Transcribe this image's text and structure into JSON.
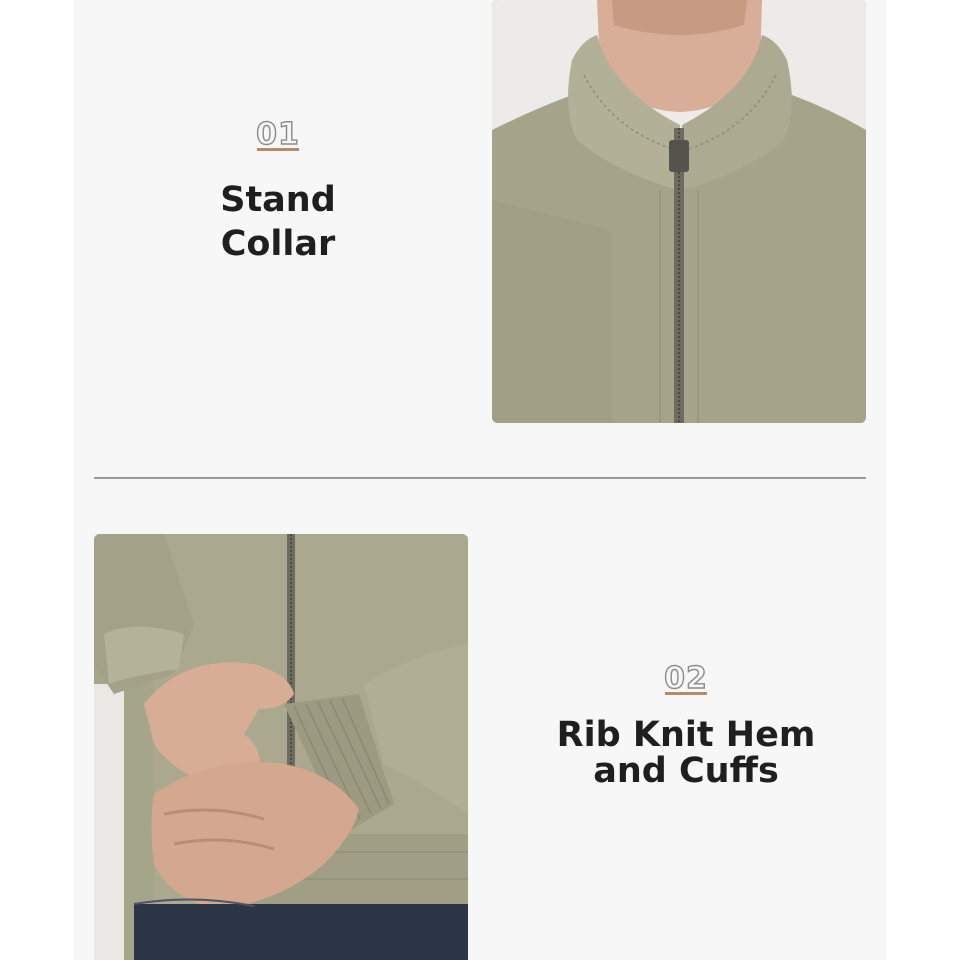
{
  "features": [
    {
      "number": "01",
      "title_lines": [
        "Stand",
        "Collar"
      ]
    },
    {
      "number": "02",
      "title_lines": [
        "Rib Knit Hem",
        "and Cuffs"
      ]
    }
  ],
  "colors": {
    "panel_background": "#f7f7f7",
    "title_text": "#1f1f1f",
    "number_outline": "#8a8a8a",
    "number_underline": "#b58a6a",
    "jacket_fabric": "#a7a68d",
    "divider": "#9a9a9a"
  },
  "images": {
    "collar_photo": "jacket-stand-collar-closeup",
    "cuff_photo": "jacket-rib-knit-cuff-closeup"
  }
}
